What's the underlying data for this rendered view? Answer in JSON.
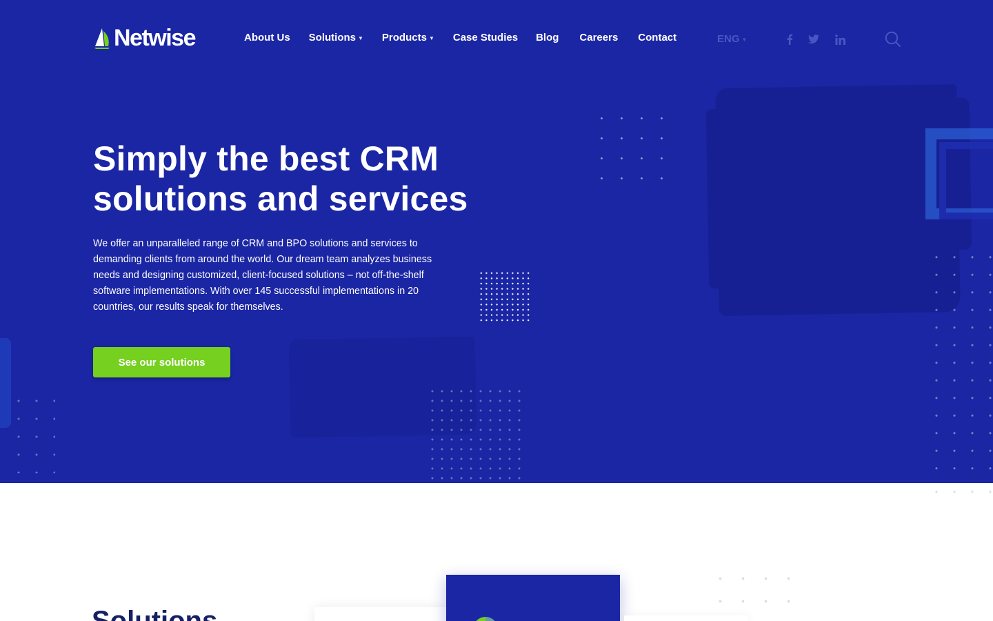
{
  "brand": {
    "name": "Netwise"
  },
  "nav": {
    "items": [
      {
        "label": "About Us",
        "has_dropdown": false
      },
      {
        "label": "Solutions",
        "has_dropdown": true
      },
      {
        "label": "Products",
        "has_dropdown": true
      },
      {
        "label": "Case Studies",
        "has_dropdown": false
      },
      {
        "label": "Blog",
        "has_dropdown": false
      },
      {
        "label": "Careers",
        "has_dropdown": false
      },
      {
        "label": "Contact",
        "has_dropdown": false
      }
    ],
    "language": "ENG",
    "social": [
      "facebook-icon",
      "twitter-icon",
      "linkedin-icon"
    ],
    "search_icon": "search-icon"
  },
  "hero": {
    "title_line1": "Simply the best CRM",
    "title_line2": "solutions and services",
    "description": "We offer an unparalleled range of CRM and BPO solutions and services to demanding clients from around the world. Our dream team analyzes business needs and designing customized, client-focused solutions – not off-the-shelf software implementations.  With over 145 successful implementations in 20 countries, our results speak for themselves.",
    "cta_label": "See our solutions"
  },
  "solutions_section": {
    "heading": "Solutions"
  },
  "colors": {
    "primary": "#1b26a4",
    "accent": "#76d020",
    "brush": "#172093",
    "heading_dark": "#162064",
    "muted_nav": "#4a55c2"
  }
}
